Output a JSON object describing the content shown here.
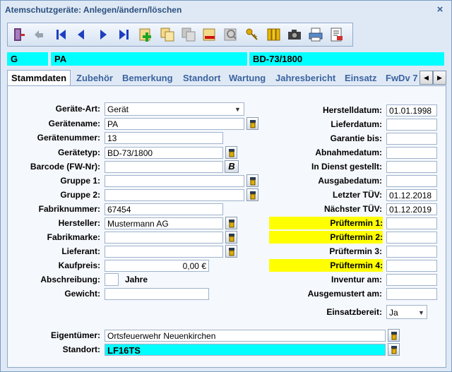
{
  "window": {
    "title": "Atemschutzgeräte: Anlegen/ändern/löschen",
    "close": "×"
  },
  "toolbar": {
    "buttons": [
      "exit-icon",
      "undo-icon",
      "first-record-icon",
      "previous-record-icon",
      "next-record-icon",
      "last-record-icon",
      "new-record-icon",
      "copy-record-icon",
      "copy-disabled-icon",
      "delete-record-icon",
      "search-icon",
      "key-icon",
      "filing-icon",
      "camera-icon",
      "print-icon",
      "report-icon"
    ]
  },
  "infobar": {
    "code": "G",
    "name": "PA",
    "type": "BD-73/1800"
  },
  "tabs": [
    "Stammdaten",
    "Zubehör",
    "Bemerkung",
    "Standort",
    "Wartung",
    "Jahresbericht",
    "Einsatz",
    "FwDv 7"
  ],
  "tab_arrows": {
    "left": "◀",
    "right": "▶"
  },
  "form": {
    "left": {
      "geraeteart": {
        "label": "Geräte-Art:",
        "value": "Gerät"
      },
      "geraetename": {
        "label": "Gerätename:",
        "value": "PA"
      },
      "geraetenummer": {
        "label": "Gerätenummer:",
        "value": "13"
      },
      "geraetetyp": {
        "label": "Gerätetyp:",
        "value": "BD-73/1800"
      },
      "barcode": {
        "label": "Barcode (FW-Nr):",
        "value": "",
        "button": "B"
      },
      "gruppe1": {
        "label": "Gruppe 1:",
        "value": ""
      },
      "gruppe2": {
        "label": "Gruppe 2:",
        "value": ""
      },
      "fabriknummer": {
        "label": "Fabriknummer:",
        "value": "67454"
      },
      "hersteller": {
        "label": "Hersteller:",
        "value": "Mustermann AG"
      },
      "fabrikmarke": {
        "label": "Fabrikmarke:",
        "value": ""
      },
      "lieferant": {
        "label": "Lieferant:",
        "value": ""
      },
      "kaufpreis": {
        "label": "Kaufpreis:",
        "value": "0,00 €"
      },
      "abschreibung": {
        "label": "Abschreibung:",
        "value": "",
        "unit": "Jahre"
      },
      "gewicht": {
        "label": "Gewicht:",
        "value": ""
      }
    },
    "right": {
      "herstelldatum": {
        "label": "Herstelldatum:",
        "value": "01.01.1998"
      },
      "lieferdatum": {
        "label": "Lieferdatum:",
        "value": ""
      },
      "garantie": {
        "label": "Garantie bis:",
        "value": ""
      },
      "abnahmedatum": {
        "label": "Abnahmedatum:",
        "value": ""
      },
      "indienst": {
        "label": "In Dienst gestellt:",
        "value": ""
      },
      "ausgabedatum": {
        "label": "Ausgabedatum:",
        "value": ""
      },
      "letzter_tuev": {
        "label": "Letzter TÜV:",
        "value": "01.12.2018"
      },
      "naechster_tuev": {
        "label": "Nächster TÜV:",
        "value": "01.12.2019"
      },
      "prueftermin1": {
        "label": "Prüftermin 1:",
        "value": ""
      },
      "prueftermin2": {
        "label": "Prüftermin 2:",
        "value": ""
      },
      "prueftermin3": {
        "label": "Prüftermin 3:",
        "value": ""
      },
      "prueftermin4": {
        "label": "Prüftermin 4:",
        "value": ""
      },
      "inventur": {
        "label": "Inventur am:",
        "value": ""
      },
      "ausgemustert": {
        "label": "Ausgemustert am:",
        "value": ""
      },
      "einsatzbereit": {
        "label": "Einsatzbereit:",
        "value": "Ja"
      }
    },
    "bottom": {
      "eigentuemer": {
        "label": "Eigentümer:",
        "value": "Ortsfeuerwehr Neuenkirchen"
      },
      "standort": {
        "label": "Standort:",
        "value": "LF16TS"
      }
    }
  },
  "colors": {
    "highlight_yellow": "#ffff00",
    "cyan": "#00ffff",
    "tab_text": "#3b63a0",
    "title": "#2b4f7e"
  }
}
